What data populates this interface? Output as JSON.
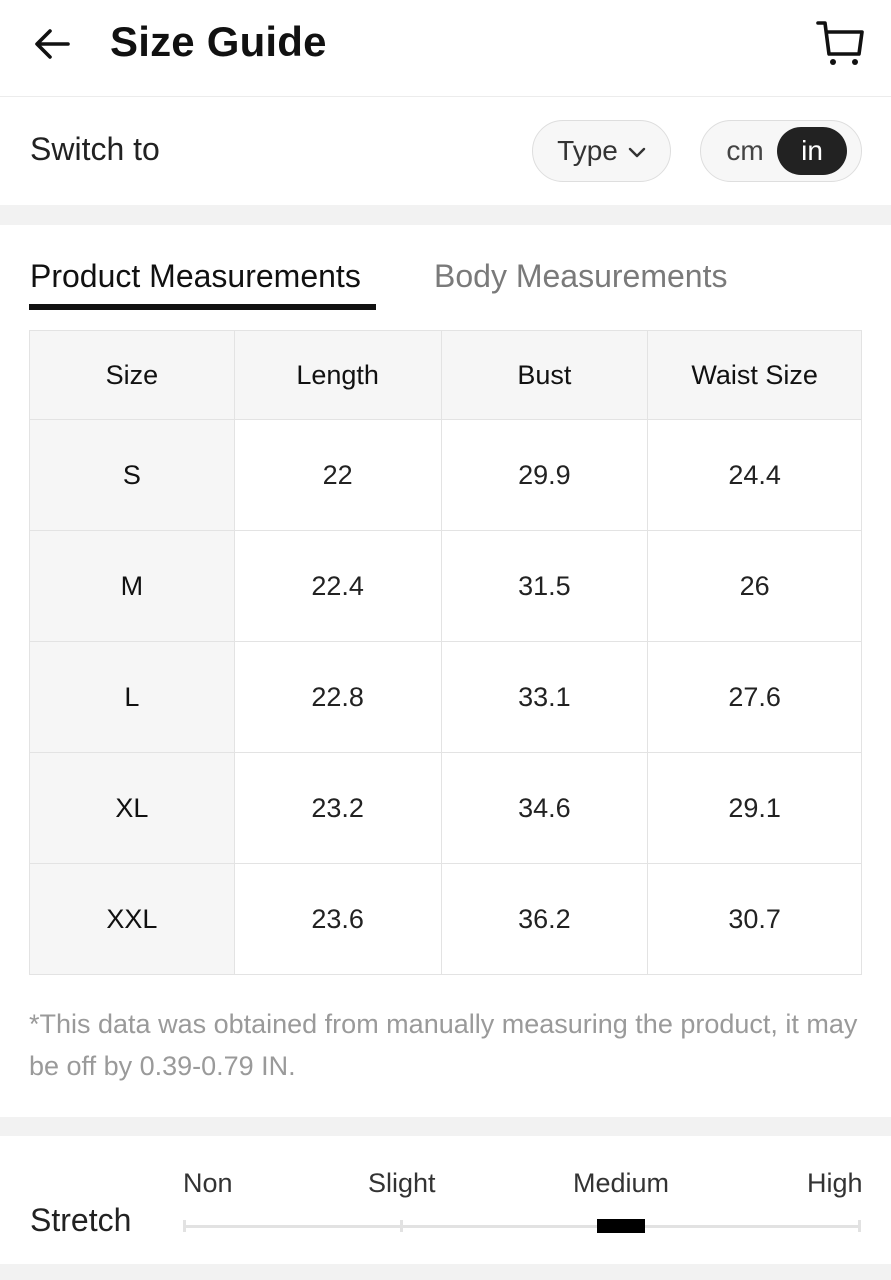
{
  "header": {
    "title": "Size Guide",
    "back_icon": "arrow-left-icon",
    "cart_icon": "cart-icon"
  },
  "switch": {
    "label": "Switch to",
    "type_label": "Type",
    "units": [
      "cm",
      "in"
    ],
    "selected_unit": "in"
  },
  "tabs": {
    "product": "Product Measurements",
    "body": "Body Measurements",
    "active": "product"
  },
  "table": {
    "headers": [
      "Size",
      "Length",
      "Bust",
      "Waist Size"
    ],
    "rows": [
      [
        "S",
        "22",
        "29.9",
        "24.4"
      ],
      [
        "M",
        "22.4",
        "31.5",
        "26"
      ],
      [
        "L",
        "22.8",
        "33.1",
        "27.6"
      ],
      [
        "XL",
        "23.2",
        "34.6",
        "29.1"
      ],
      [
        "XXL",
        "23.6",
        "36.2",
        "30.7"
      ]
    ]
  },
  "note": "*This data was obtained from manually measuring the product, it may be off by 0.39-0.79 IN.",
  "stretch": {
    "label": "Stretch",
    "levels": [
      "Non",
      "Slight",
      "Medium",
      "High"
    ],
    "selected": "Medium"
  },
  "colors": {
    "accent": "#111111",
    "muted_text": "#9a9a9a",
    "section_gap": "#f2f2f2",
    "table_header_bg": "#f6f6f6"
  }
}
